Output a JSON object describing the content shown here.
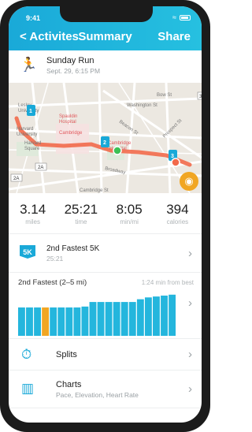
{
  "status": {
    "time": "9:41"
  },
  "nav": {
    "back_label": "< Activites",
    "title": "Summary",
    "share_label": "Share"
  },
  "run": {
    "title": "Sunday Run",
    "date": "Sept. 29, 6:15 PM"
  },
  "map": {
    "labels": [
      "Lesley",
      "University",
      "Harvard",
      "University",
      "Harvard",
      "Square",
      "Spauldin",
      "Hospital",
      "Cambridge",
      "Cambridge",
      "Hospital",
      "Bow St",
      "Washington St",
      "Beacon St",
      "Broadway",
      "Prospect St",
      "2A",
      "2A",
      "3",
      "Cambridge St"
    ],
    "markers": [
      "1",
      "2",
      "3"
    ],
    "accent": "#f26a4b"
  },
  "stats": [
    {
      "value": "3.14",
      "label": "miles"
    },
    {
      "value": "25:21",
      "label": "time"
    },
    {
      "value": "8:05",
      "label": "min/mi"
    },
    {
      "value": "394",
      "label": "calories"
    }
  ],
  "achievement": {
    "badge": "5K",
    "title": "2nd Fastest 5K",
    "time": "25:21"
  },
  "comparison": {
    "title": "2nd Fastest (2–5 mi)",
    "delta": "1:24 min from best",
    "colors": {
      "bar": "#24b6dd",
      "highlight": "#f1a623"
    }
  },
  "chart_data": {
    "type": "bar",
    "title": "2nd Fastest (2–5 mi)",
    "values": [
      0.62,
      0.62,
      0.62,
      0.62,
      0.62,
      0.62,
      0.62,
      0.62,
      0.64,
      0.74,
      0.74,
      0.74,
      0.74,
      0.74,
      0.74,
      0.8,
      0.84,
      0.86,
      0.88,
      0.9
    ],
    "highlight_index": 3,
    "ylim": [
      0,
      1
    ]
  },
  "rows": {
    "splits": {
      "label": "Splits"
    },
    "charts": {
      "label": "Charts",
      "sub": "Pace, Elevation, Heart Rate"
    }
  }
}
